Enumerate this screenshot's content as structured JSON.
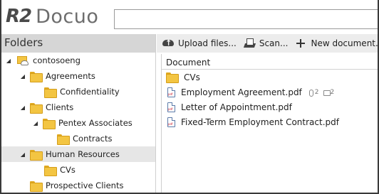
{
  "app": {
    "logo_mark": "R2",
    "logo_name": "Docuo"
  },
  "search": {
    "value": "",
    "placeholder": ""
  },
  "sidebar": {
    "title": "Folders",
    "tree": [
      {
        "label": "contosoeng",
        "level": 0,
        "expanded": true,
        "root": true
      },
      {
        "label": "Agreements",
        "level": 1,
        "expanded": true
      },
      {
        "label": "Confidentiality",
        "level": 2
      },
      {
        "label": "Clients",
        "level": 1,
        "expanded": true
      },
      {
        "label": "Pentex Associates",
        "level": 2,
        "expanded": true
      },
      {
        "label": "Contracts",
        "level": 3
      },
      {
        "label": "Human Resources",
        "level": 1,
        "expanded": true,
        "selected": true
      },
      {
        "label": "CVs",
        "level": 2
      },
      {
        "label": "Prospective Clients",
        "level": 1
      }
    ]
  },
  "toolbar": {
    "upload_label": "Upload files...",
    "scan_label": "Scan...",
    "new_label": "New document..."
  },
  "documents": {
    "column_header": "Document",
    "rows": [
      {
        "type": "folder",
        "name": "CVs"
      },
      {
        "type": "pdf",
        "name": "Employment Agreement.pdf",
        "attachments": "2",
        "comments": "2"
      },
      {
        "type": "pdf",
        "name": "Letter of Appointment.pdf"
      },
      {
        "type": "pdf",
        "name": "Fixed-Term Employment Contract.pdf"
      }
    ]
  }
}
